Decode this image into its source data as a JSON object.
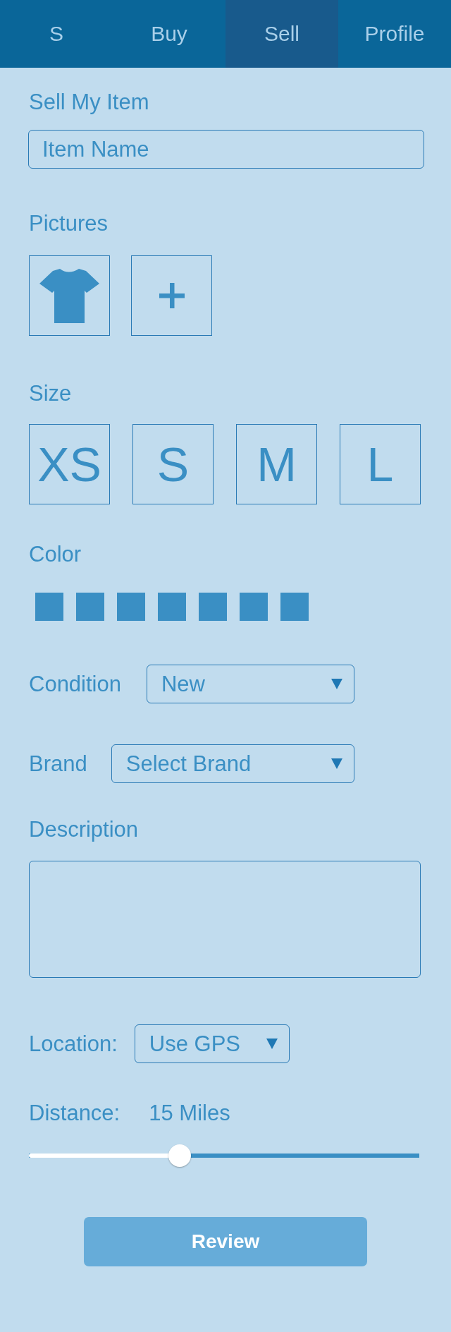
{
  "tabs": [
    {
      "label": "S",
      "selected": false
    },
    {
      "label": "Buy",
      "selected": false
    },
    {
      "label": "Sell",
      "selected": true
    },
    {
      "label": "Profile",
      "selected": false
    }
  ],
  "title": "Sell My Item",
  "item_name": {
    "placeholder": "Item Name"
  },
  "pictures": {
    "label": "Pictures",
    "items": [
      {
        "kind": "thumbnail"
      },
      {
        "kind": "add"
      }
    ]
  },
  "size": {
    "label": "Size",
    "options": [
      {
        "label": "XS",
        "selected": false
      },
      {
        "label": "S",
        "selected": false
      },
      {
        "label": "M",
        "selected": false
      },
      {
        "label": "L",
        "selected": false
      }
    ]
  },
  "color": {
    "label": "Color",
    "swatches": [
      {
        "color": "#3a8fc4"
      },
      {
        "color": "#3a8fc4"
      },
      {
        "color": "#3a8fc4"
      },
      {
        "color": "#3a8fc4"
      },
      {
        "color": "#3a8fc4"
      },
      {
        "color": "#3a8fc4"
      },
      {
        "color": "#3a8fc4"
      }
    ]
  },
  "condition": {
    "label": "Condition",
    "value": "New"
  },
  "brand": {
    "label": "Brand",
    "value": "Select Brand"
  },
  "description": {
    "label": "Description"
  },
  "location": {
    "label": "Location:",
    "value": "Use GPS"
  },
  "distance": {
    "label": "Distance:",
    "reading": "15 Miles",
    "level": 0.38
  },
  "review_button": {
    "label": "Review"
  }
}
